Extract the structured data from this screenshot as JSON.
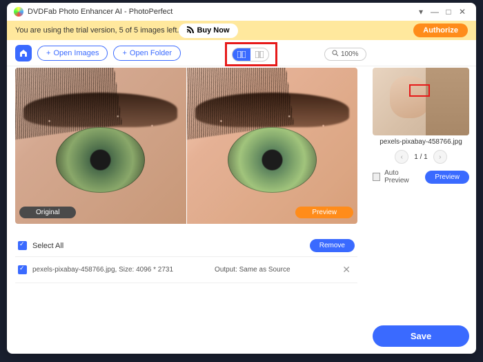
{
  "title": "DVDFab Photo Enhancer AI - PhotoPerfect",
  "trial": {
    "message": "You are using the trial version, 5 of 5 images left.",
    "buy_now": "Buy Now",
    "authorize": "Authorize"
  },
  "toolbar": {
    "open_images": "Open Images",
    "open_folder": "Open Folder",
    "zoom": "100%"
  },
  "preview": {
    "original_label": "Original",
    "preview_label": "Preview"
  },
  "list": {
    "select_all": "Select All",
    "remove": "Remove",
    "file": {
      "name_size": "pexels-pixabay-458766.jpg, Size: 4096 * 2731",
      "output": "Output: Same as Source"
    }
  },
  "sidebar": {
    "filename": "pexels-pixabay-458766.jpg",
    "pager": "1 / 1",
    "auto_preview": "Auto Preview",
    "preview_btn": "Preview",
    "save": "Save"
  }
}
